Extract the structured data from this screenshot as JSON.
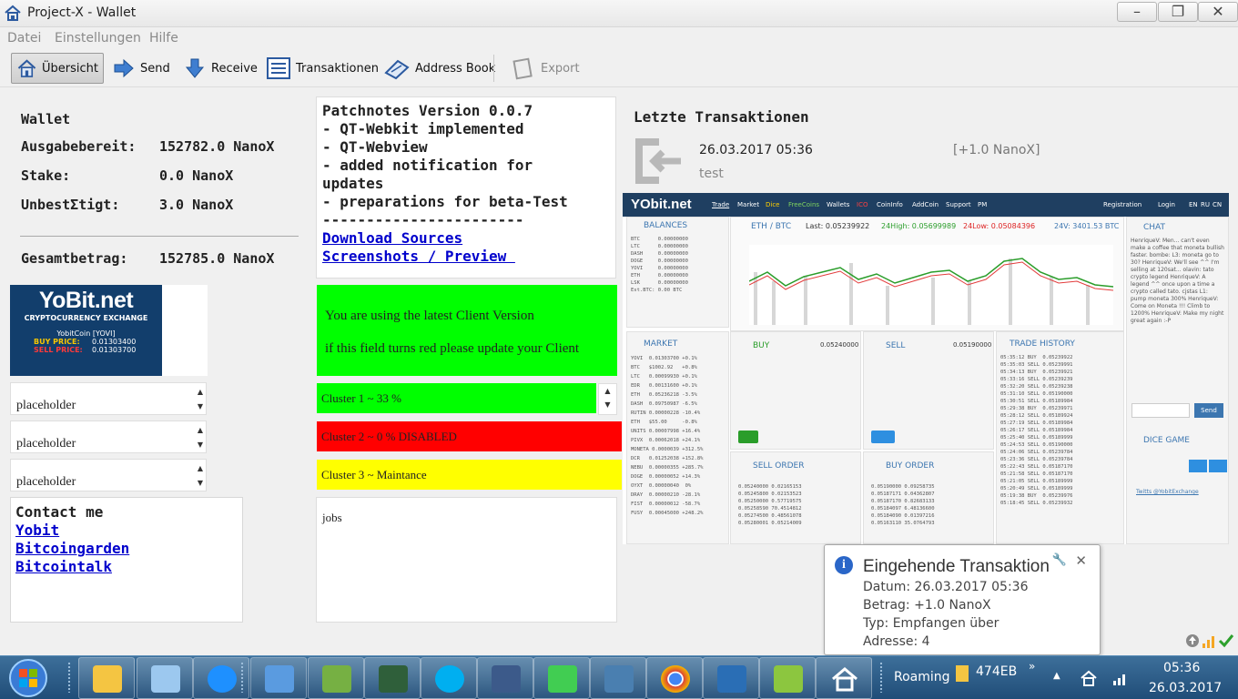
{
  "window": {
    "title": "Project-X - Wallet"
  },
  "menu": [
    "Datei",
    "Einstellungen",
    "Hilfe"
  ],
  "toolbar": {
    "overview": "Übersicht",
    "send": "Send",
    "receive": "Receive",
    "transactions": "Transaktionen",
    "address_book": "Address Book",
    "export": "Export"
  },
  "wallet": {
    "heading": "Wallet",
    "rows": [
      {
        "label": "Ausgabebereit:",
        "value": "152782.0 NanoX"
      },
      {
        "label": "Stake:",
        "value": "0.0 NanoX"
      },
      {
        "label": "UnbestΣtigt:",
        "value": "3.0 NanoX"
      }
    ],
    "total_label": "Gesamtbetrag:",
    "total_value": "152785.0 NanoX"
  },
  "yobit_logo": {
    "name": "YoBit.net",
    "sub": "CRYPTOCURRENCY EXCHANGE",
    "coin": "YobitCoin [YOVI]",
    "buy_label": "BUY PRICE:",
    "buy_value": "0.01303400",
    "sell_label": "SELL PRICE:",
    "sell_value": "0.01303700"
  },
  "placeholders": [
    "placeholder",
    "placeholder",
    "placeholder"
  ],
  "contact": {
    "title": "Contact me",
    "links": [
      "Yobit",
      "Bitcoingarden",
      "Bitcointalk"
    ]
  },
  "patchnotes": {
    "lines": [
      "Patchnotes Version 0.0.7",
      "- QT-Webkit implemented",
      "- QT-Webview",
      "- added notification for",
      "updates",
      "- preparations for beta-Test",
      "-----------------------"
    ],
    "link_download": "Download Sources",
    "link_screens": "Screenshots / Preview "
  },
  "version_box": {
    "line1": "You are using the latest Client Version",
    "line2": "if this field turns red please update your Client",
    "color": "#00ff00"
  },
  "clusters": [
    {
      "label": "Cluster 1 ~ 33 %",
      "color": "#00ff00"
    },
    {
      "label": "Cluster 2 ~ 0 % DISABLED",
      "color": "#ff0000"
    },
    {
      "label": "Cluster 3 ~ Maintance",
      "color": "#ffff00"
    }
  ],
  "jobs": "jobs",
  "recent": {
    "heading": "Letzte Transaktionen",
    "date": "26.03.2017 05:36",
    "amount": "[+1.0 NanoX]",
    "label": "test"
  },
  "yobit_screen": {
    "brand": "YObit.net",
    "nav": [
      "Trade",
      "Market",
      "Dice",
      "FreeCoins",
      "Wallets",
      "ICO",
      "CoinInfo",
      "AddCoin",
      "Support",
      "PM"
    ],
    "nav_right": [
      "Registration",
      "Login",
      "EN",
      "RU",
      "CN"
    ],
    "balances": "BALANCES",
    "pair": "ETH / BTC",
    "last": "Last: 0.05239922",
    "high": "24High: 0.05699989",
    "low": "24Low: 0.05084396",
    "vol": "24V: 3401.53 BTC",
    "market": "MARKET",
    "buy": "BUY",
    "sell": "SELL",
    "trade_history": "TRADE HISTORY",
    "sell_order": "SELL ORDER",
    "buy_order": "BUY ORDER",
    "chat": "CHAT",
    "dice": "DICE GAME",
    "buy_price": "0.05240000",
    "sell_price": "0.05190000",
    "send_btn": "Send",
    "twitter": "Twitts @YobitExchange"
  },
  "notification": {
    "title": "Eingehende Transaktion",
    "lines": [
      "Datum: 26.03.2017 05:36",
      "Betrag: +1.0 NanoX",
      "Typ: Empfangen über",
      "Adresse: 4"
    ]
  },
  "taskbar": {
    "roaming": "Roaming",
    "folder": "474EB",
    "time": "05:36",
    "date": "26.03.2017"
  }
}
